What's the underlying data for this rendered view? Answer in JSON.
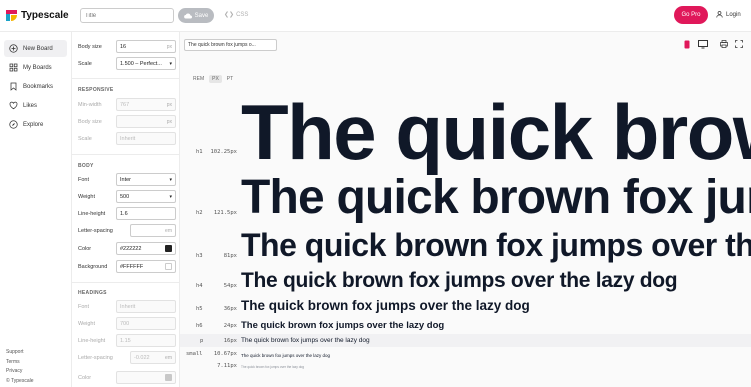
{
  "app": {
    "name": "Typescale",
    "title_placeholder": "Title",
    "save_label": "Save",
    "css_label": "CSS",
    "gopro_label": "Go Pro",
    "login_label": "Login",
    "brand_color": "#e0185a"
  },
  "sidebar": {
    "items": [
      {
        "label": "New Board",
        "icon": "plus-circle-icon"
      },
      {
        "label": "My Boards",
        "icon": "grid-icon"
      },
      {
        "label": "Bookmarks",
        "icon": "bookmark-icon"
      },
      {
        "label": "Likes",
        "icon": "heart-icon"
      },
      {
        "label": "Explore",
        "icon": "compass-icon"
      }
    ],
    "footer": [
      "Support",
      "Terms",
      "Privacy",
      "© Typescale"
    ]
  },
  "settings": {
    "body_size": {
      "label": "Body size",
      "value": "16",
      "unit": "px"
    },
    "scale": {
      "label": "Scale",
      "value": "1.500 – Perfect..."
    },
    "responsive": {
      "title": "RESPONSIVE",
      "min_width": {
        "label": "Min-width",
        "value": "767",
        "unit": "px"
      },
      "body_size": {
        "label": "Body size",
        "value": "",
        "unit": "px"
      },
      "scale": {
        "label": "Scale",
        "value": "Inherit"
      }
    },
    "body": {
      "title": "BODY",
      "font": {
        "label": "Font",
        "value": "Inter"
      },
      "weight": {
        "label": "Weight",
        "value": "500"
      },
      "line_height": {
        "label": "Line-height",
        "value": "1.6"
      },
      "letter_spacing": {
        "label": "Letter-spacing",
        "value": "",
        "unit": "em"
      },
      "color": {
        "label": "Color",
        "value": "#222222",
        "swatch": "#222222"
      },
      "background": {
        "label": "Background",
        "value": "#FFFFFF",
        "swatch": "#FFFFFF"
      }
    },
    "headings": {
      "title": "HEADINGS",
      "font": {
        "label": "Font",
        "value": "Inherit"
      },
      "weight": {
        "label": "Weight",
        "value": "700"
      },
      "line_height": {
        "label": "Line-height",
        "value": "1.15"
      },
      "letter_spacing": {
        "label": "Letter-spacing",
        "value": "-0.022",
        "unit": "em"
      },
      "color": {
        "label": "Color",
        "value": "",
        "swatch": "#c8c8c8"
      }
    }
  },
  "preview": {
    "text": "The quick brown fox jumps over the lazy dog",
    "input_value": "The quick brown fox jumps o...",
    "units": [
      "REM",
      "PX",
      "PT"
    ],
    "active_unit": "PX",
    "rows": [
      {
        "tag": "h1",
        "size": "102.25px",
        "sample": "The quick brown fox jumps over the lazy dog"
      },
      {
        "tag": "h2",
        "size": "121.5px",
        "sample": "The quick brown fox jumps over the lazy dog"
      },
      {
        "tag": "h3",
        "size": "81px",
        "sample": "The quick brown fox jumps over the lazy dog"
      },
      {
        "tag": "h4",
        "size": "54px",
        "sample": "The quick brown fox jumps over the lazy dog"
      },
      {
        "tag": "h5",
        "size": "36px",
        "sample": "The quick brown fox jumps over the lazy dog"
      },
      {
        "tag": "h6",
        "size": "24px",
        "sample": "The quick brown fox jumps over the lazy dog"
      },
      {
        "tag": "p",
        "size": "16px",
        "sample": "The quick brown fox jumps over the lazy dog"
      },
      {
        "tag": "small",
        "size": "10.67px",
        "sample": "The quick brown fox jumps over the lazy dog"
      },
      {
        "tag": "",
        "size": "7.11px",
        "sample": "The quick brown fox jumps over the lazy dog"
      }
    ]
  }
}
